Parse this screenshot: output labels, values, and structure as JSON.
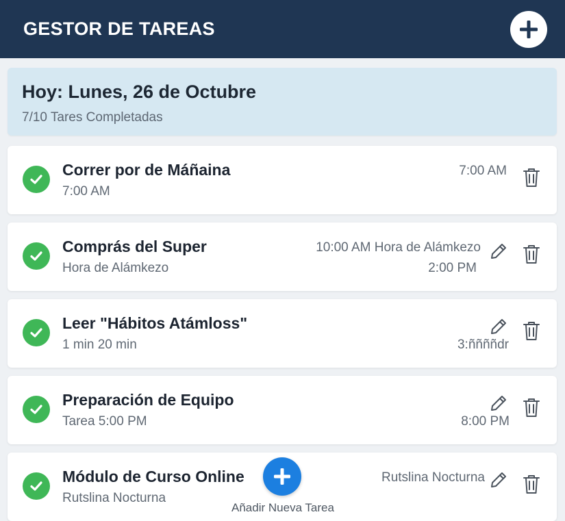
{
  "header": {
    "title": "GESTOR DE TAREAS",
    "add_icon": "plus-icon"
  },
  "summary": {
    "date": "Hoy: Lunes, 26 de Octubre",
    "progress": "7/10 Tares Completadas"
  },
  "tasks": [
    {
      "title": "Correr por de Máñaina",
      "subtitle": "7:00 AM",
      "time_top": "7:00 AM",
      "time_bottom": "",
      "completed": true,
      "icons": [
        "check-icon",
        "trash-icon"
      ]
    },
    {
      "title": "Comprás del Super",
      "subtitle": "Hora de Alámkezo",
      "time_top": "10:00 AM Hora de Alámkezo",
      "time_bottom": "2:00 PM",
      "completed": true,
      "icons": [
        "check-icon",
        "pencil-icon",
        "trash-icon"
      ]
    },
    {
      "title": "Leer \"Hábitos Atámloss\"",
      "subtitle": "1 min 20 min",
      "time_top": "",
      "time_bottom": "3:ññññdr",
      "completed": true,
      "icons": [
        "check-icon",
        "pencil-icon",
        "trash-icon"
      ]
    },
    {
      "title": "Preparación de Equipo",
      "subtitle": "Tarea 5:00 PM",
      "time_top": "",
      "time_bottom": "8:00 PM",
      "completed": true,
      "icons": [
        "check-icon",
        "pencil-icon",
        "trash-icon"
      ]
    },
    {
      "title": "Módulo de Curso Online",
      "subtitle": "Rutslina Nocturna",
      "time_top": "Rutslina Nocturna",
      "time_bottom": "",
      "completed": true,
      "icons": [
        "check-icon",
        "pencil-icon",
        "trash-icon"
      ]
    }
  ],
  "fab": {
    "label": "Añadir Nueva Tarea",
    "icon": "plus-icon"
  },
  "colors": {
    "header_bg": "#1f3653",
    "summary_bg": "#d6e8f2",
    "check_green": "#3fb757",
    "fab_blue": "#1c7fe0"
  }
}
